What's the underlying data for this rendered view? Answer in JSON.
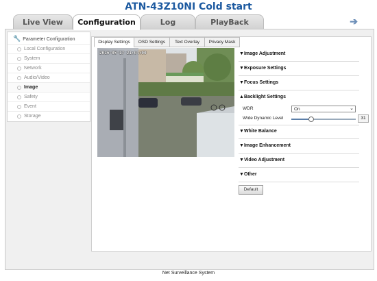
{
  "app": {
    "title": "ATN-43Z10NI Cold start",
    "footer": "Net Surveillance System"
  },
  "tabs": [
    {
      "label": "Live View",
      "active": false
    },
    {
      "label": "Configuration",
      "active": true
    },
    {
      "label": "Log",
      "active": false
    },
    {
      "label": "PlayBack",
      "active": false
    }
  ],
  "toolbar": {
    "logout_icon": "arrow-right-icon"
  },
  "sidebar": {
    "header": "Parameter Configuration",
    "items": [
      {
        "label": "Local Configuration",
        "active": false
      },
      {
        "label": "System",
        "active": false
      },
      {
        "label": "Network",
        "active": false
      },
      {
        "label": "Audio/Video",
        "active": false
      },
      {
        "label": "Image",
        "active": true
      },
      {
        "label": "Safety",
        "active": false
      },
      {
        "label": "Event",
        "active": false
      },
      {
        "label": "Storage",
        "active": false
      }
    ]
  },
  "subtabs": [
    {
      "label": "Display Settings",
      "active": true
    },
    {
      "label": "OSD Settings",
      "active": false
    },
    {
      "label": "Text Overlay",
      "active": false
    },
    {
      "label": "Privacy Mask",
      "active": false
    }
  ],
  "video": {
    "osd_text": "2016-05-17 21:04:00"
  },
  "settings": {
    "sections": {
      "image_adjustment": "Image Adjustment",
      "exposure": "Exposure Settings",
      "focus": "Focus Settings",
      "backlight": "Backlight Settings",
      "white_balance": "White Balance",
      "enhancement": "Image Enhancement",
      "video_adjustment": "Video Adjustment",
      "other": "Other"
    },
    "collapsed_glyph": "▼",
    "expanded_glyph": "▲",
    "wdr": {
      "label": "WDR",
      "value": "On"
    },
    "wide_dynamic_level": {
      "label": "Wide Dynamic Level",
      "value": "31",
      "fraction": 0.31
    },
    "default_label": "Default"
  },
  "colors": {
    "title": "#1d5aa0",
    "accent": "#6d8fb8"
  }
}
